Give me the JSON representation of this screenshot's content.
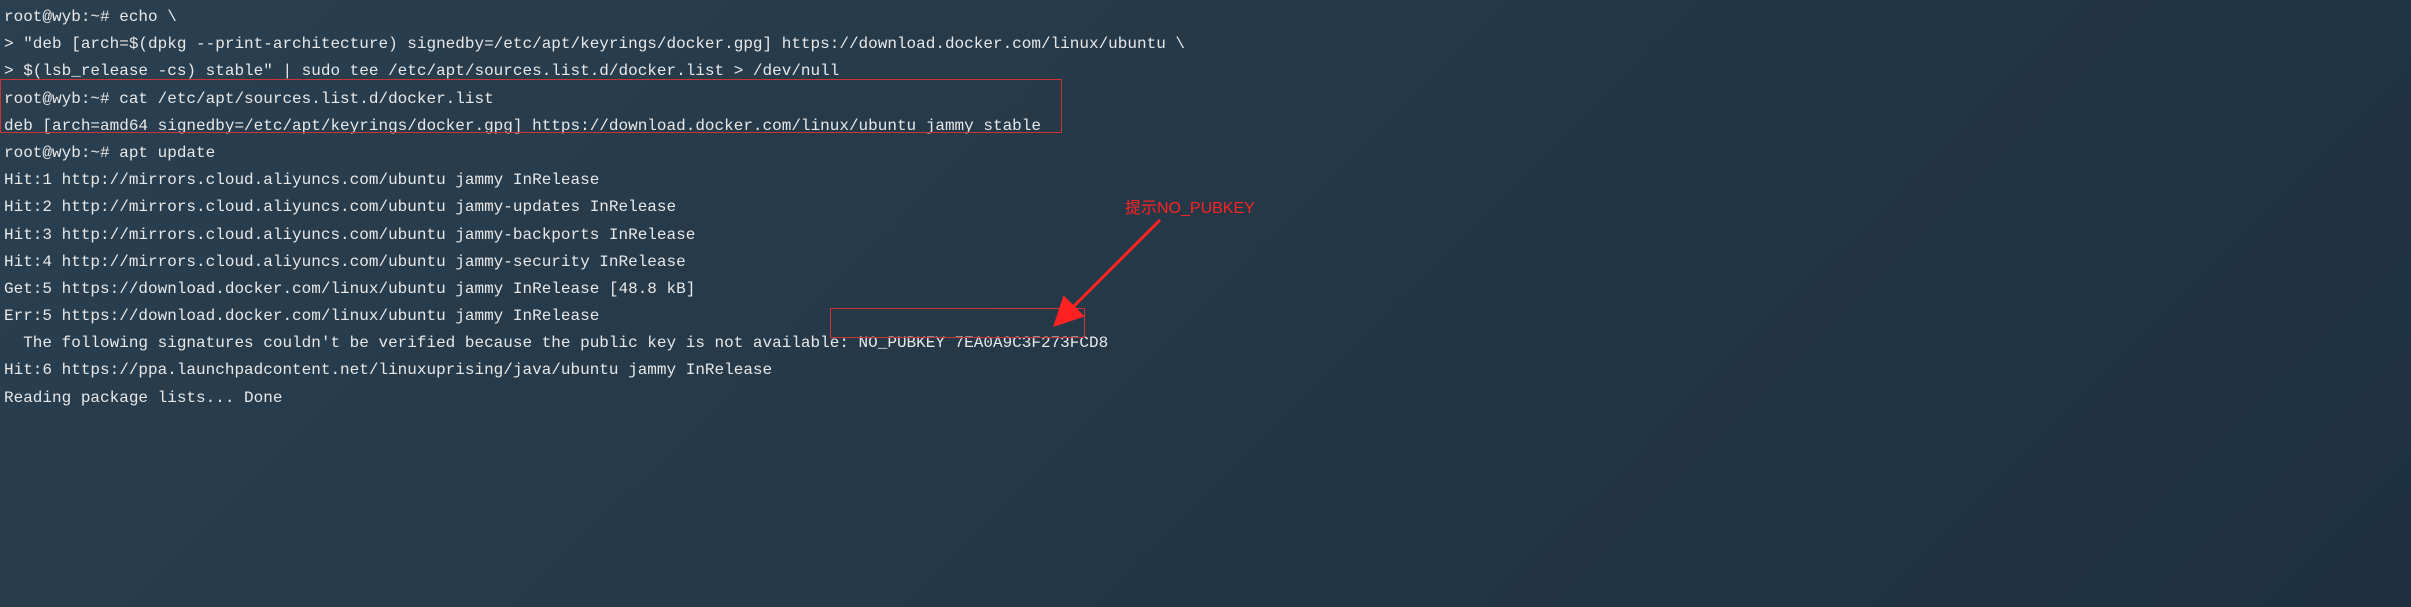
{
  "lines": {
    "l1": "root@wyb:~# echo \\",
    "l2": "> \"deb [arch=$(dpkg --print-architecture) signedby=/etc/apt/keyrings/docker.gpg] https://download.docker.com/linux/ubuntu \\",
    "l3": "> $(lsb_release -cs) stable\" | sudo tee /etc/apt/sources.list.d/docker.list > /dev/null",
    "l4": "root@wyb:~# cat /etc/apt/sources.list.d/docker.list",
    "l5": "deb [arch=amd64 signedby=/etc/apt/keyrings/docker.gpg] https://download.docker.com/linux/ubuntu jammy stable",
    "l6": "root@wyb:~# apt update",
    "l7": "Hit:1 http://mirrors.cloud.aliyuncs.com/ubuntu jammy InRelease",
    "l8": "Hit:2 http://mirrors.cloud.aliyuncs.com/ubuntu jammy-updates InRelease",
    "l9": "Hit:3 http://mirrors.cloud.aliyuncs.com/ubuntu jammy-backports InRelease",
    "l10": "Hit:4 http://mirrors.cloud.aliyuncs.com/ubuntu jammy-security InRelease",
    "l11": "Get:5 https://download.docker.com/linux/ubuntu jammy InRelease [48.8 kB]",
    "l12": "Err:5 https://download.docker.com/linux/ubuntu jammy InRelease",
    "l13": "  The following signatures couldn't be verified because the public key is not available: NO_PUBKEY 7EA0A9C3F273FCD8",
    "l14": "Hit:6 https://ppa.launchpadcontent.net/linuxuprising/java/ubuntu jammy InRelease",
    "l15": "Reading package lists... Done"
  },
  "annotation": {
    "text": "提示NO_PUBKEY"
  }
}
